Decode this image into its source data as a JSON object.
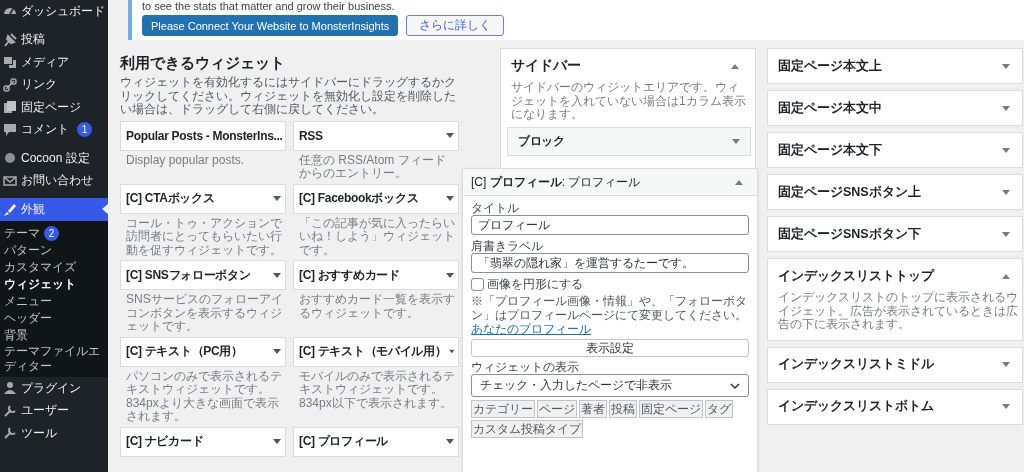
{
  "admin_menu": {
    "items": [
      {
        "label": "ダッシュボード",
        "selected": false
      },
      {
        "label": "投稿",
        "selected": false
      },
      {
        "label": "メディア",
        "selected": false
      },
      {
        "label": "リンク",
        "selected": false
      },
      {
        "label": "固定ページ",
        "selected": false
      },
      {
        "label": "コメント",
        "selected": false,
        "badge": "1"
      },
      {
        "label": "Cocoon 設定",
        "selected": false
      },
      {
        "label": "お問い合わせ",
        "selected": false
      },
      {
        "label": "外観",
        "selected": true,
        "children": [
          {
            "label": "テーマ",
            "selected": false,
            "badge": "2"
          },
          {
            "label": "パターン",
            "selected": false
          },
          {
            "label": "カスタマイズ",
            "selected": false
          },
          {
            "label": "ウィジェット",
            "selected": true
          },
          {
            "label": "メニュー",
            "selected": false
          },
          {
            "label": "ヘッダー",
            "selected": false
          },
          {
            "label": "背景",
            "selected": false
          },
          {
            "label": "テーマファイルエディター",
            "selected": false
          }
        ]
      },
      {
        "label": "プラグイン",
        "selected": false
      },
      {
        "label": "ユーザー",
        "selected": false
      },
      {
        "label": "ツール",
        "selected": false
      }
    ]
  },
  "notice": {
    "text": "to see the stats that matter and grow their business.",
    "primary_button": "Please Connect Your Website to MonsterInsights",
    "secondary_button": "さらに詳しく"
  },
  "available_widgets": {
    "title": "利用できるウィジェット",
    "description": "ウィジェットを有効化するにはサイドバーにドラッグするかクリックしてください。ウィジェットを無効化し設定を削除したい場合は、ドラッグして右側に戻してください。",
    "widgets": [
      {
        "title": "Popular Posts - MonsterIns...",
        "description": "Display popular posts."
      },
      {
        "title": "RSS",
        "description": "任意の RSS/Atom フィードからのエントリー。"
      },
      {
        "title": "[C] CTAボックス",
        "description": "コール・トゥ・アクションで訪問者にとってもらいたい行動を促すウィジェットです。"
      },
      {
        "title": "[C] Facebookボックス",
        "description": "「この記事が気に入ったらいいね！しよう」ウィジェットです。"
      },
      {
        "title": "[C] SNSフォローボタン",
        "description": "SNSサービスのフォローアイコンボタンを表示するウィジェットです。"
      },
      {
        "title": "[C] おすすめカード",
        "description": "おすすめカード一覧を表示するウィジェットです。"
      },
      {
        "title": "[C] テキスト（PC用）",
        "description": "パソコンのみで表示されるテキストウィジェットです。834pxより大きな画面で表示されます。"
      },
      {
        "title": "[C] テキスト（モバイル用）",
        "description": "モバイルのみで表示されるテキストウィジェットです。834px以下で表示されます。"
      },
      {
        "title": "[C] ナビカード"
      },
      {
        "title": "[C] プロフィール"
      }
    ]
  },
  "sidebar_area": {
    "title": "サイドバー",
    "expanded": true,
    "description": "サイドバーのウィジットエリアです。ウィジェットを入れていない場合は1カラム表示になります。",
    "widgets": [
      {
        "title": "ブロック",
        "expanded": false
      }
    ]
  },
  "dragged_widget": {
    "title": "[C] **プロフィール**: プロフィール",
    "expanded": true,
    "title_label": "タイトル",
    "title_value": "プロフィール",
    "caption_label": "肩書きラベル",
    "caption_value": "「翡翠の隠れ家」を運営するたーです。",
    "round_image": {
      "label": "画像を円形にする",
      "checked": false
    },
    "note": "※「プロフィール画像・情報」や、「フォローボタン」はプロフィールページにて変更してください。",
    "profile_link": "あなたのプロフィール",
    "display_settings_button": "表示設定",
    "visibility_label": "ウィジェットの表示",
    "visibility_value": "チェック・入力したページで非表示",
    "tabs": [
      "カテゴリー",
      "ページ",
      "著者",
      "投稿",
      "固定ページ",
      "タグ",
      "カスタム投稿タイプ"
    ]
  },
  "widget_areas": [
    {
      "title": "固定ページ本文上",
      "expanded": false
    },
    {
      "title": "固定ページ本文中",
      "expanded": false
    },
    {
      "title": "固定ページ本文下",
      "expanded": false
    },
    {
      "title": "固定ページSNSボタン上",
      "expanded": false
    },
    {
      "title": "固定ページSNSボタン下",
      "expanded": false
    },
    {
      "title": "インデックスリストトップ",
      "expanded": true,
      "description": "インデックスリストのトップに表示されるウイジェット。広告が表示されているときは広告の下に表示されます。"
    },
    {
      "title": "インデックスリストミドル",
      "expanded": false
    },
    {
      "title": "インデックスリストボトム",
      "expanded": false
    }
  ]
}
